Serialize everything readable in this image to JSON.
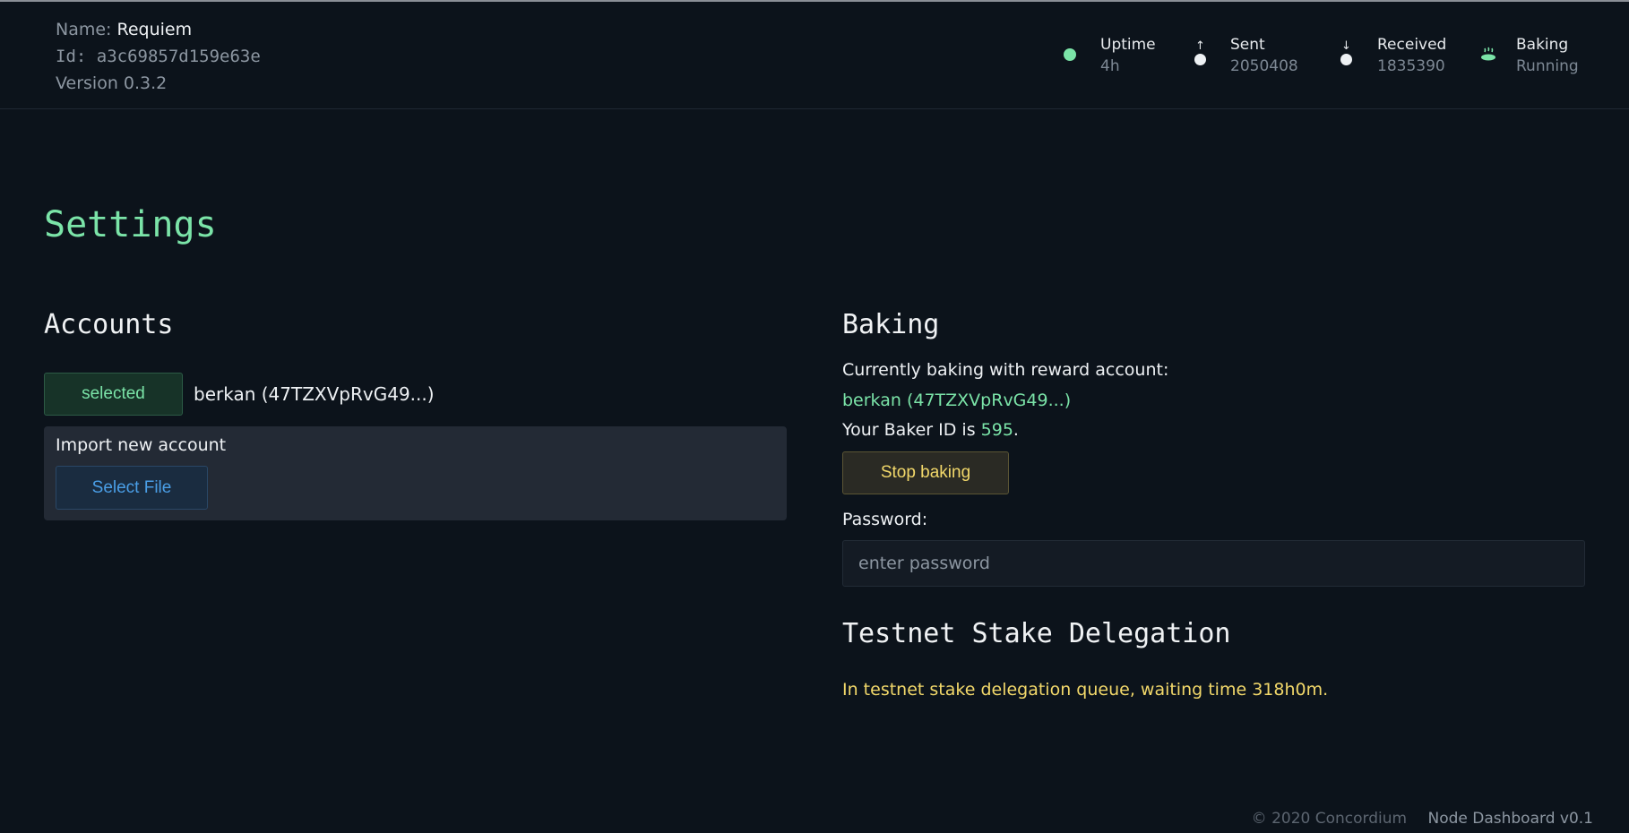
{
  "header": {
    "name_label": "Name: ",
    "name_value": "Requiem",
    "id_line": "Id: a3c69857d159e63e",
    "version_line": "Version 0.3.2",
    "stats": [
      {
        "label": "Uptime",
        "value": "4h",
        "icon": "status-dot-icon"
      },
      {
        "label": "Sent",
        "value": "2050408",
        "icon": "upload-icon"
      },
      {
        "label": "Received",
        "value": "1835390",
        "icon": "download-icon"
      },
      {
        "label": "Baking",
        "value": "Running",
        "icon": "bread-icon"
      }
    ]
  },
  "page": {
    "title": "Settings"
  },
  "accounts": {
    "title": "Accounts",
    "selected_label": "selected",
    "account_name": "berkan (47TZXVpRvG49...)",
    "import_label": "Import new account",
    "select_file_label": "Select File"
  },
  "baking": {
    "title": "Baking",
    "currently_text": "Currently baking with reward account:",
    "reward_account": "berkan (47TZXVpRvG49...)",
    "baker_id_prefix": "Your Baker ID is ",
    "baker_id": "595",
    "baker_id_suffix": ".",
    "stop_label": "Stop baking",
    "password_label": "Password:",
    "password_placeholder": "enter password"
  },
  "delegation": {
    "title": "Testnet Stake Delegation",
    "message": "In testnet stake delegation queue, waiting time 318h0m."
  },
  "footer": {
    "copyright": "© 2020 Concordium",
    "dashboard_version": "Node Dashboard v0.1"
  },
  "colors": {
    "background": "#0c131b",
    "accent_green": "#7be4a8",
    "warning_yellow": "#f2d86a",
    "link_blue": "#4a9ee6"
  }
}
